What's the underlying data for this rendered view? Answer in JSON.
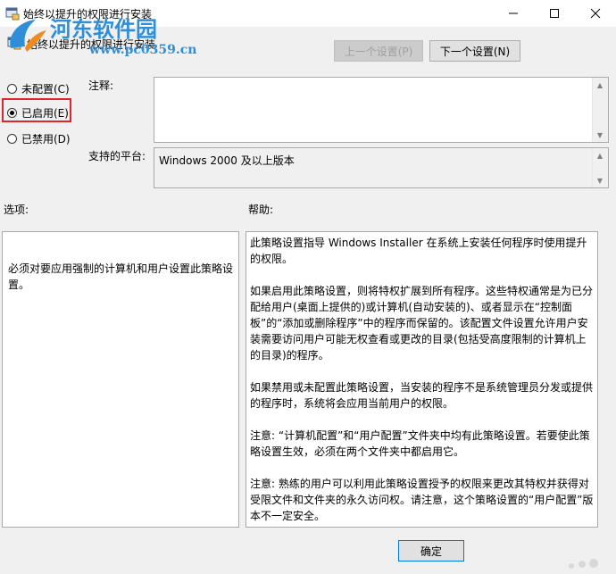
{
  "window": {
    "title": "始终以提升的权限进行安装",
    "setting_title": "始终以提升的权限进行安装",
    "controls": {
      "minimize_icon": "minimize-icon",
      "maximize_icon": "maximize-icon",
      "close_icon": "close-icon"
    }
  },
  "watermark": {
    "name": "河东软件园",
    "url": "www.pc0359.cn"
  },
  "nav": {
    "prev_label": "上一个设置(P)",
    "next_label": "下一个设置(N)"
  },
  "state": {
    "options": [
      {
        "label": "未配置(C)",
        "checked": false
      },
      {
        "label": "已启用(E)",
        "checked": true
      },
      {
        "label": "已禁用(D)",
        "checked": false
      }
    ]
  },
  "comment": {
    "label": "注释:",
    "value": ""
  },
  "platform": {
    "label": "支持的平台:",
    "value": "Windows 2000 及以上版本"
  },
  "options_section": {
    "label": "选项:",
    "text": "必须对要应用强制的计算机和用户设置此策略设置。"
  },
  "help_section": {
    "label": "帮助:",
    "paragraphs": [
      "此策略设置指导 Windows Installer 在系统上安装任何程序时使用提升的权限。",
      "如果启用此策略设置，则将特权扩展到所有程序。这些特权通常是为已分配给用户(桌面上提供的)或计算机(自动安装的)、或者显示在“控制面板”的“添加或删除程序”中的程序而保留的。该配置文件设置允许用户安装需要访问用户可能无权查看或更改的目录(包括受高度限制的计算机上的目录)的程序。",
      "如果禁用或未配置此策略设置，当安装的程序不是系统管理员分发或提供的程序时，系统将会应用当前用户的权限。",
      "注意: “计算机配置”和“用户配置”文件夹中均有此策略设置。若要使此策略设置生效，必须在两个文件夹中都启用它。",
      "注意: 熟练的用户可以利用此策略设置授予的权限来更改其特权并获得对受限文件和文件夹的永久访问权。请注意，这个策略设置的“用户配置”版本不一定安全。"
    ]
  },
  "footer": {
    "ok_label": "确定"
  },
  "colors": {
    "highlight": "#e0242c",
    "watermark": "#2e8fd8",
    "ok_border": "#0078d7"
  }
}
